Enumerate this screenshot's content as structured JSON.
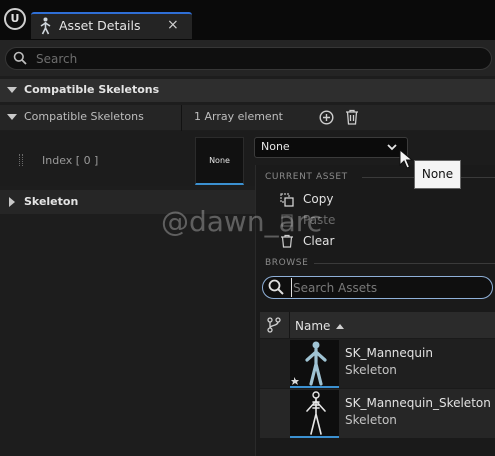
{
  "app": {
    "logo_letter": "U"
  },
  "tab": {
    "title": "Asset Details",
    "close_glyph": "×"
  },
  "search": {
    "placeholder": "Search"
  },
  "section": {
    "title": "Compatible Skeletons"
  },
  "property": {
    "name": "Compatible Skeletons",
    "value": "1 Array element",
    "index_label": "Index [ 0 ]",
    "thumbnail_label": "None",
    "combo_value": "None"
  },
  "skeleton_row": {
    "label": "Skeleton"
  },
  "dropdown": {
    "current_asset_header": "CURRENT ASSET",
    "copy_label": "Copy",
    "paste_label": "Paste",
    "clear_label": "Clear",
    "browse_header": "BROWSE",
    "search_placeholder": "Search Assets",
    "name_column": "Name",
    "assets": [
      {
        "name": "SK_Mannequin",
        "type": "Skeleton"
      },
      {
        "name": "SK_Mannequin_Skeleton",
        "type": "Skeleton"
      }
    ]
  },
  "tooltip": {
    "text": "None"
  },
  "watermark": {
    "text": "@dawn_arc"
  },
  "colors": {
    "accent_blue": "#2f6fd6",
    "thumb_underline": "#3b90d0",
    "panel_bg": "#1d1d1d"
  }
}
